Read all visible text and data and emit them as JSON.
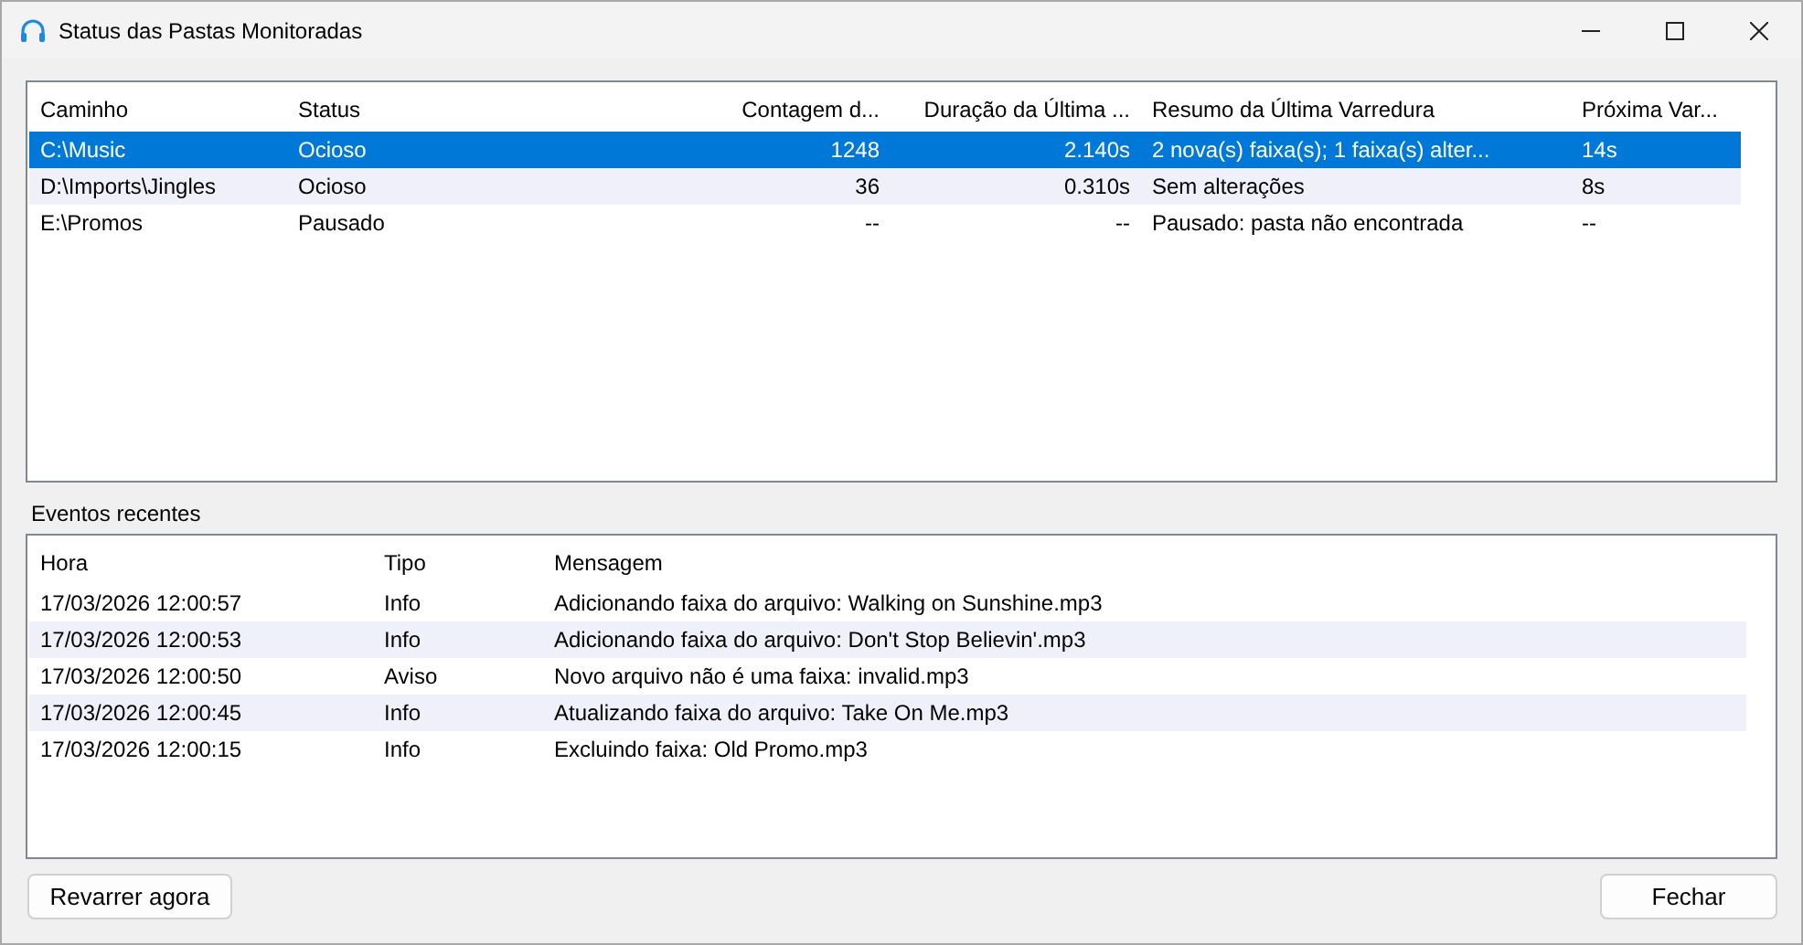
{
  "window": {
    "title": "Status das Pastas Monitoradas"
  },
  "folders": {
    "columns": [
      "Caminho",
      "Status",
      "Contagem d...",
      "Duração da Última ...",
      "Resumo da Última Varredura",
      "Próxima Var..."
    ],
    "rows": [
      {
        "cells": [
          "C:\\Music",
          "Ocioso",
          "1248",
          "2.140s",
          "2 nova(s) faixa(s); 1 faixa(s) alter...",
          "14s"
        ],
        "selected": true
      },
      {
        "cells": [
          "D:\\Imports\\Jingles",
          "Ocioso",
          "36",
          "0.310s",
          "Sem alterações",
          "8s"
        ],
        "selected": false
      },
      {
        "cells": [
          "E:\\Promos",
          "Pausado",
          "--",
          "--",
          "Pausado: pasta não encontrada",
          "--"
        ],
        "selected": false
      }
    ]
  },
  "events": {
    "label": "Eventos recentes",
    "columns": [
      "Hora",
      "Tipo",
      "Mensagem"
    ],
    "rows": [
      [
        "17/03/2026 12:00:57",
        "Info",
        "Adicionando faixa do arquivo: Walking on Sunshine.mp3"
      ],
      [
        "17/03/2026 12:00:53",
        "Info",
        "Adicionando faixa do arquivo: Don't Stop Believin'.mp3"
      ],
      [
        "17/03/2026 12:00:50",
        "Aviso",
        "Novo arquivo não é uma faixa: invalid.mp3"
      ],
      [
        "17/03/2026 12:00:45",
        "Info",
        "Atualizando faixa do arquivo: Take On Me.mp3"
      ],
      [
        "17/03/2026 12:00:15",
        "Info",
        "Excluindo faixa: Old Promo.mp3"
      ]
    ]
  },
  "buttons": {
    "scan": "Revarrer agora",
    "close": "Fechar"
  }
}
